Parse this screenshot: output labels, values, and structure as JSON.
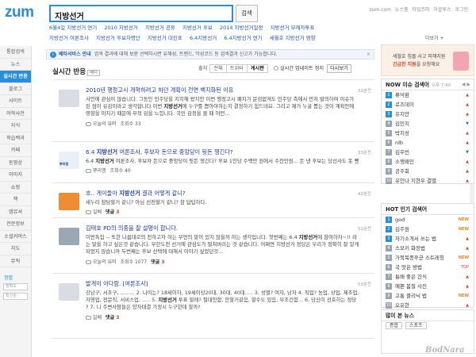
{
  "header": {
    "logo": "zum",
    "search_value": "지방선거",
    "search_button": "검색",
    "top_links": [
      "zum.com",
      "뉴스줌",
      "타임즈미",
      "아굴루스",
      "로그인"
    ]
  },
  "related": {
    "row1": [
      "6월4일 지방선거 연기",
      "2010 지방선거",
      "지방선거 공휴",
      "지방선거 후보",
      "2014 지방선거일정",
      "지방선거 부재자투표"
    ],
    "row2": [
      "지방선거 여론조사",
      "지방선거 후보자명단",
      "지방선거 대진표",
      "6.4지방선거",
      "6.4지방선거 연기",
      "세월호 지방선거 영향"
    ],
    "more": "더보기 +"
  },
  "leftnav": {
    "items": [
      "통합검색",
      "뉴스",
      "실시간 반응",
      "블로그",
      "사이트",
      "어학사전",
      "지식",
      "학습백과",
      "카페",
      "동영상",
      "이미지",
      "쇼핑",
      "책",
      "앱뮤셔",
      "전문정보",
      "소셜커머스",
      "지도",
      "뮤직"
    ],
    "active_index": 2,
    "option_title": "정렬",
    "options": [
      "정확도",
      "최신순"
    ]
  },
  "betabar": {
    "icon": "i",
    "label": "베타서비스 안내",
    "text": "검색 결과에 대해 보완 선택하시면 유해성, 트렌드, 악성코드 등 검색결과 신고가 가능합니다.",
    "close": "×"
  },
  "section": {
    "title": "실시간 반응",
    "badge": "베타",
    "filter_label": "출처",
    "filters": [
      "전체",
      "트위터",
      "게시판"
    ],
    "active_filter": 2,
    "realtime_label": "실시간 업데이트 정지",
    "refresh": "다시보기"
  },
  "posts": [
    {
      "title": "2010년 행정고시 개혁하려고 하던 계획이 전면 백지화된 이유",
      "text_before": "사인에 관심이 많습니다. 그동안 민주당을 지지해 왔지만 이번 행정고시 폐지가 문검없게도 민주당 측에서 먼저 발의하여 이슈가 된 점이 유감이라고 생각합니다 이번 ",
      "text_bold": "지방선거",
      "text_after": "에 누구를 뽑아야하는지 결정하기 힘드네요. 그리고 제가 누굴 뽑는 것이 계획안에 영향을 미치기 때문에 무척 감을 느낍니다. 국민 감정을 볼 때 어떤...",
      "source": "오늘의 유머",
      "views_label": "조회수 33",
      "comments_label": "",
      "time": "32분전"
    },
    {
      "title_before": "6.4 ",
      "title_bold": "지방선거",
      "title_after": " 여론조사, 후보자 돈으로 중앙당이 뒷돈 챙긴다?",
      "text_before": "6.4 ",
      "text_bold": "지방선거",
      "text_after": " 여론조사, 후보자 돈으로 중앙당이 뒷돈 챙긴다? 후보 1인당 수백만 원에서 수천만원... 돈 낸 후보는 당선사도 돗 뺀",
      "source": "뿌리엠",
      "views_label": "조회수 40",
      "comments_label": "",
      "time": "33분전"
    },
    {
      "title_before": "흐.. 게이들아 ",
      "title_bold": "지방선거",
      "title_after": " 결과 어떻게 같니?",
      "text": "새누리 참담할거 같니? 아님 선전할거 같니? 참 답답하다.",
      "source": "일베",
      "views_label": "",
      "comment_word": "댓글",
      "comment_count": "3",
      "time": "42분전"
    },
    {
      "title": "김태호 PD의 의중을 잘 설명이 합니다.",
      "text_before": "이번특집 -- 또한 나름대로의 전하고자 하는 무언의 말이 있지 않을까 하는 생각입니다. 첫번째는 6.4 ",
      "text_bold": "지방선거",
      "text_after": "에 참여하자~!! 라는 말을 하고 싶은것 같습니다. 무한도전 선거에 관심도가 떨쳐버리는 것 같습니다. 어쩌면 지방선거 정당은 우리가 정확히 잘 알게 되었지 않습니까 두번째는 후보 선택에 대해서 이야기 싶었던것...",
      "source": "오늘의 유머",
      "views_label": "조회수 1077",
      "comment_word": "댓글",
      "comment_count": "3",
      "time": "51분전"
    },
    {
      "title": "발게이 아다람. [여론조사]",
      "text_before": "강남구, 서초구, ......... 2. 나이는? 18세이하, 19세이상20대, 30대, 40대..... 3. 성별? 여자, 남자 4. 직업? 농업, 상업, 제조업, 자영업, 전문직, 서비스업, ..... 5. ",
      "text_bold": "지방선거",
      "text_after": " 투표 할래? 절대안함, 안할거같음, 할수도 있음, 무조건함... 6. 당신이 선호하는 정당 ? 7. 니 주변사람들은 양자대결 가정시 누구한데 할까?",
      "source": "일베",
      "views_label": "",
      "comment_word": "댓글",
      "comment_count": "3",
      "time": "53분전"
    }
  ],
  "ad": {
    "line1": "세월호 침몰 사고 피해지원",
    "line2_before": "",
    "line2_bold": "긴급한 지원",
    "line2_after": "을 요청해요"
  },
  "now_panel": {
    "title": "NOW 이슈 검색어",
    "sub": "오후 7:40",
    "controls": "◀ ▶",
    "items": [
      {
        "rank": "1",
        "keyword": "류덕환",
        "trend": "up",
        "mark": "▲"
      },
      {
        "rank": "2",
        "keyword": "로즈데이",
        "trend": "up",
        "mark": "▲"
      },
      {
        "rank": "3",
        "keyword": "유지안",
        "trend": "up",
        "mark": "▲"
      },
      {
        "rank": "4",
        "keyword": "김민지",
        "trend": "down",
        "mark": "▼"
      },
      {
        "rank": "5",
        "keyword": "박지성",
        "trend": "up",
        "mark": "▲"
      },
      {
        "rank": "6",
        "keyword": "nlb",
        "trend": "up",
        "mark": "▲"
      },
      {
        "rank": "7",
        "keyword": "김우빈",
        "trend": "down",
        "mark": "▼"
      },
      {
        "rank": "8",
        "keyword": "소행왜인",
        "trend": "up",
        "mark": "▲"
      },
      {
        "rank": "9",
        "keyword": "공주회",
        "trend": "up",
        "mark": "▲"
      },
      {
        "rank": "10",
        "keyword": "유인나 지현우 결별",
        "trend": "up",
        "mark": "▲"
      }
    ]
  },
  "hot_panel": {
    "title": "HOT 인기 검색어",
    "sub": "",
    "items": [
      {
        "rank": "1",
        "keyword": "god",
        "trend": "new",
        "mark": "NEW"
      },
      {
        "rank": "2",
        "keyword": "김주원",
        "trend": "new",
        "mark": "NEW"
      },
      {
        "rank": "3",
        "keyword": "자기소개서 쓰는 법",
        "trend": "up",
        "mark": "▲"
      },
      {
        "rank": "4",
        "keyword": "스모키 화장법",
        "trend": "up",
        "mark": "▲"
      },
      {
        "rank": "5",
        "keyword": "가북목증후군 스트레칭",
        "trend": "new",
        "mark": "NEW"
      },
      {
        "rank": "6",
        "keyword": "국 맛은 방법",
        "trend": "up",
        "mark": "TOP"
      },
      {
        "rank": "7",
        "keyword": "퉁배 좋은 간식",
        "trend": "up",
        "mark": "▲"
      },
      {
        "rank": "8",
        "keyword": "예쁜 봄철 사진",
        "trend": "up",
        "mark": "▲"
      },
      {
        "rank": "9",
        "keyword": "고통 클리닉 법",
        "trend": "new",
        "mark": "NEW"
      },
      {
        "rank": "10",
        "keyword": "오유한",
        "trend": "up",
        "mark": "▲"
      }
    ]
  },
  "news_panel": {
    "title": "많이 본 뉴스",
    "tabs": [
      "종합",
      "스포츠"
    ]
  },
  "watermark": "BodNara"
}
